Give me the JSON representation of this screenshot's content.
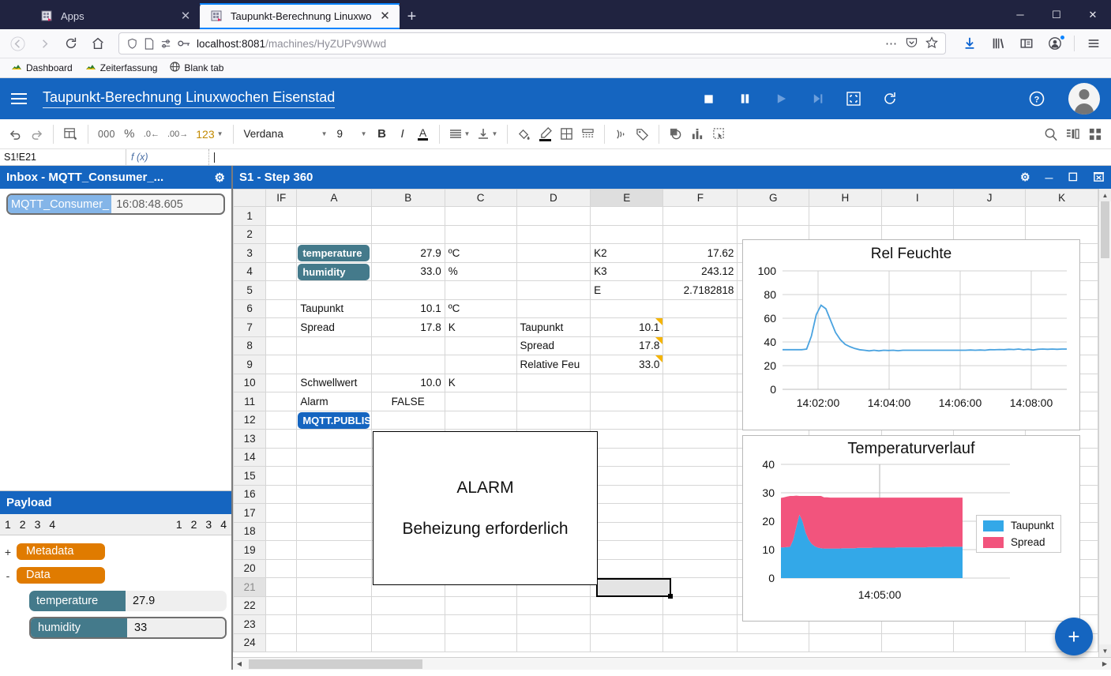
{
  "browser": {
    "tabs": [
      {
        "label": "Apps",
        "active": false,
        "favicon": "apps-favicon"
      },
      {
        "label": "Taupunkt-Berechnung Linuxwo",
        "active": true,
        "favicon": "page-favicon"
      }
    ],
    "new_tab_label": "+",
    "window_controls": {
      "minimize": "─",
      "maximize": "☐",
      "close": "✕"
    },
    "nav": {
      "back": "←",
      "forward": "→",
      "reload": "↻",
      "home": "⌂"
    },
    "url": {
      "host": "localhost:8081",
      "path": "/machines/HyZUPv9Wwd"
    },
    "urlbar_icons": [
      "shield-icon",
      "page-icon",
      "permissions-icon",
      "key-icon"
    ],
    "urlbar_right_icons": [
      "ellipsis-icon",
      "pocket-icon",
      "bookmark-star-icon"
    ],
    "toolbar_right_icons": [
      "downloads-icon",
      "library-icon",
      "sidebar-icon",
      "account-icon",
      "app-menu-icon"
    ],
    "bookmarks": [
      {
        "label": "Dashboard",
        "icon": "green-hill-icon"
      },
      {
        "label": "Zeiterfassung",
        "icon": "green-hill-icon"
      },
      {
        "label": "Blank tab",
        "icon": "globe-icon"
      }
    ]
  },
  "app": {
    "title": "Taupunkt-Berechnung Linuxwochen Eisenstad",
    "menu_icon": "hamburger-icon",
    "controls": [
      {
        "name": "stop-button",
        "glyph": "■",
        "state": "enabled"
      },
      {
        "name": "pause-button",
        "glyph": "❙❙",
        "state": "enabled"
      },
      {
        "name": "play-button",
        "glyph": "▶",
        "state": "disabled"
      },
      {
        "name": "step-button",
        "glyph": "▶|",
        "state": "disabled"
      },
      {
        "name": "fullscreen-button",
        "glyph": "⬚",
        "state": "enabled"
      },
      {
        "name": "reset-button",
        "glyph": "↻",
        "state": "enabled"
      },
      {
        "name": "help-button",
        "glyph": "?",
        "state": "enabled"
      }
    ],
    "avatar": "user-avatar"
  },
  "toolbar": {
    "undo": "↶",
    "redo": "↷",
    "format_painter": "format-as-table-icon",
    "thousands": "000",
    "percent": "%",
    "decimal_decrease": ".0",
    "decimal_increase": ".00",
    "number_format": "123",
    "font_family": "Verdana",
    "font_size": "9",
    "bold": "B",
    "italic": "I",
    "underline_color": "A",
    "align": "align-icon",
    "valign": "valign-icon",
    "fill_color": "paint-bucket-icon",
    "text_color": "pen-icon",
    "borders": "borders-icon",
    "merge": "merge-cells-icon",
    "broadcast": "broadcast-icon",
    "tag": "tag-icon",
    "shape": "shape-icon",
    "chart": "chart-icon",
    "select_range": "select-range-icon",
    "zoom": "magnifier-icon",
    "panels": "panel-layout-icon",
    "apps": "apps-grid-icon"
  },
  "formula_bar": {
    "cell_ref": "S1!E21",
    "fx_label": "f (x)",
    "value": ""
  },
  "inbox": {
    "title": "Inbox - MQTT_Consumer_...",
    "gear": "gear-icon",
    "message": {
      "key": "MQTT_Consumer_",
      "value": "16:08:48.605"
    }
  },
  "payload": {
    "title": "Payload",
    "left_numbers": [
      "1",
      "2",
      "3",
      "4"
    ],
    "right_numbers": [
      "1",
      "2",
      "3",
      "4"
    ],
    "nodes": [
      {
        "toggle": "+",
        "label": "Metadata",
        "type": "group"
      },
      {
        "toggle": "-",
        "label": "Data",
        "type": "group"
      }
    ],
    "fields": [
      {
        "key": "temperature",
        "value": "27.9",
        "selected": false
      },
      {
        "key": "humidity",
        "value": "33",
        "selected": true
      }
    ]
  },
  "sheet": {
    "title": "S1 - Step 360",
    "window_controls": [
      {
        "name": "sheet-settings-button",
        "glyph": "⚙"
      },
      {
        "name": "sheet-minimize-button",
        "glyph": "─"
      },
      {
        "name": "sheet-maximize-button",
        "glyph": "☐"
      },
      {
        "name": "sheet-delete-button",
        "glyph": "⌧"
      }
    ],
    "columns": [
      "IF",
      "A",
      "B",
      "C",
      "D",
      "E",
      "F",
      "G",
      "H",
      "I",
      "J",
      "K"
    ],
    "active_column": "E",
    "active_row": "21",
    "rows": [
      "1",
      "2",
      "3",
      "4",
      "5",
      "6",
      "7",
      "8",
      "9",
      "10",
      "11",
      "12",
      "13",
      "14",
      "15",
      "16",
      "17",
      "18",
      "19",
      "20",
      "21",
      "22",
      "23",
      "24"
    ],
    "cells": [
      {
        "row": 3,
        "col": "A",
        "text": "temperature",
        "style": "tag-teal"
      },
      {
        "row": 3,
        "col": "B",
        "text": "27.9",
        "style": "num"
      },
      {
        "row": 3,
        "col": "C",
        "text": "ºC",
        "style": "text"
      },
      {
        "row": 3,
        "col": "E",
        "text": "K2",
        "style": "text"
      },
      {
        "row": 3,
        "col": "F",
        "text": "17.62",
        "style": "num"
      },
      {
        "row": 4,
        "col": "A",
        "text": "humidity",
        "style": "tag-teal"
      },
      {
        "row": 4,
        "col": "B",
        "text": "33.0",
        "style": "num"
      },
      {
        "row": 4,
        "col": "C",
        "text": "%",
        "style": "text"
      },
      {
        "row": 4,
        "col": "E",
        "text": "K3",
        "style": "text"
      },
      {
        "row": 4,
        "col": "F",
        "text": "243.12",
        "style": "num"
      },
      {
        "row": 5,
        "col": "E",
        "text": "E",
        "style": "text"
      },
      {
        "row": 5,
        "col": "F",
        "text": "2.7182818",
        "style": "num"
      },
      {
        "row": 6,
        "col": "A",
        "text": "Taupunkt",
        "style": "text"
      },
      {
        "row": 6,
        "col": "B",
        "text": "10.1",
        "style": "num"
      },
      {
        "row": 6,
        "col": "C",
        "text": "ºC",
        "style": "text"
      },
      {
        "row": 7,
        "col": "A",
        "text": "Spread",
        "style": "text"
      },
      {
        "row": 7,
        "col": "B",
        "text": "17.8",
        "style": "num"
      },
      {
        "row": 7,
        "col": "C",
        "text": "K",
        "style": "text"
      },
      {
        "row": 7,
        "col": "D",
        "text": "Taupunkt",
        "style": "text"
      },
      {
        "row": 7,
        "col": "E",
        "text": "10.1",
        "style": "num-note"
      },
      {
        "row": 8,
        "col": "D",
        "text": "Spread",
        "style": "text"
      },
      {
        "row": 8,
        "col": "E",
        "text": "17.8",
        "style": "num-note"
      },
      {
        "row": 9,
        "col": "D",
        "text": "Relative Feu",
        "style": "text"
      },
      {
        "row": 9,
        "col": "E",
        "text": "33.0",
        "style": "num-note"
      },
      {
        "row": 10,
        "col": "A",
        "text": "Schwellwert",
        "style": "text"
      },
      {
        "row": 10,
        "col": "B",
        "text": "10.0",
        "style": "num"
      },
      {
        "row": 10,
        "col": "C",
        "text": "K",
        "style": "text"
      },
      {
        "row": 11,
        "col": "A",
        "text": "Alarm",
        "style": "text"
      },
      {
        "row": 11,
        "col": "B",
        "text": "FALSE",
        "style": "center"
      },
      {
        "row": 12,
        "col": "A",
        "text": "MQTT.PUBLISH",
        "style": "tag-blue"
      }
    ]
  },
  "alarm": {
    "title": "ALARM",
    "message": "Beheizung erforderlich"
  },
  "fab": {
    "label": "+",
    "name": "add-button"
  },
  "chart_data": [
    {
      "type": "line",
      "title": "Rel Feuchte",
      "xlabel": "",
      "ylabel": "",
      "ylim": [
        0,
        100
      ],
      "yticks": [
        "0",
        "20",
        "40",
        "60",
        "80",
        "100"
      ],
      "xticks": [
        "14:02:00",
        "14:04:00",
        "14:06:00",
        "14:08:00"
      ],
      "grid": true,
      "series": [
        {
          "name": "Rel Feuchte",
          "color": "#4aa3e0",
          "values": [
            33.5,
            33.5,
            33.5,
            33.5,
            33.5,
            34,
            45,
            63,
            71,
            68,
            58,
            48,
            42,
            38,
            36,
            34.5,
            33.5,
            33,
            32.5,
            33,
            32.5,
            33,
            32.8,
            33,
            32.6,
            33,
            33,
            33,
            33,
            33,
            33,
            33,
            33,
            33,
            33,
            33,
            33,
            33,
            33,
            33.2,
            33,
            33.2,
            33,
            33.5,
            33.4,
            33.6,
            33.5,
            33.8,
            33.6,
            34,
            33.4,
            33.8,
            33.2,
            33.8,
            34,
            33.8,
            34,
            33.8,
            34,
            34
          ]
        }
      ]
    },
    {
      "type": "area",
      "title": "Temperaturverlauf",
      "xlabel": "",
      "ylabel": "",
      "ylim": [
        0,
        40
      ],
      "yticks": [
        "0",
        "10",
        "20",
        "30",
        "40"
      ],
      "xticks": [
        "14:05:00"
      ],
      "grid": true,
      "stacked": true,
      "legend_position": "right",
      "series": [
        {
          "name": "Taupunkt",
          "color": "#33a8e8",
          "values": [
            10.8,
            10.8,
            10.9,
            11.0,
            13.5,
            18.0,
            22.3,
            20.0,
            16.0,
            13.5,
            12.0,
            11.2,
            10.7,
            10.5,
            10.4,
            10.4,
            10.4,
            10.4,
            10.4,
            10.4,
            10.5,
            10.5,
            10.5,
            10.5,
            10.5,
            10.6,
            10.6,
            10.6,
            10.6,
            10.6,
            10.7,
            10.7,
            10.7,
            10.7,
            10.7,
            10.7,
            10.7,
            10.7,
            10.8,
            10.8,
            10.8,
            10.8,
            10.8,
            10.8,
            10.8,
            10.8,
            10.8,
            10.8,
            10.9,
            10.9,
            10.9,
            10.9,
            10.9,
            11.0,
            11.0,
            11.0,
            11.0,
            11.0,
            11.0,
            11.0
          ]
        },
        {
          "name": "Spread",
          "color": "#f2547d",
          "values": [
            17.4,
            17.6,
            17.8,
            17.9,
            15.4,
            11.0,
            6.6,
            8.9,
            12.9,
            15.4,
            16.9,
            17.7,
            18.2,
            18.4,
            18.0,
            18.0,
            17.9,
            17.9,
            17.9,
            17.9,
            17.8,
            17.8,
            17.8,
            17.8,
            17.8,
            17.7,
            17.7,
            17.7,
            17.7,
            17.7,
            17.6,
            17.6,
            17.6,
            17.6,
            17.6,
            17.6,
            17.6,
            17.6,
            17.5,
            17.5,
            17.5,
            17.5,
            17.5,
            17.5,
            17.5,
            17.5,
            17.5,
            17.5,
            17.4,
            17.4,
            17.4,
            17.4,
            17.4,
            17.3,
            17.3,
            17.3,
            17.3,
            17.3,
            17.3,
            17.3
          ]
        }
      ]
    }
  ]
}
